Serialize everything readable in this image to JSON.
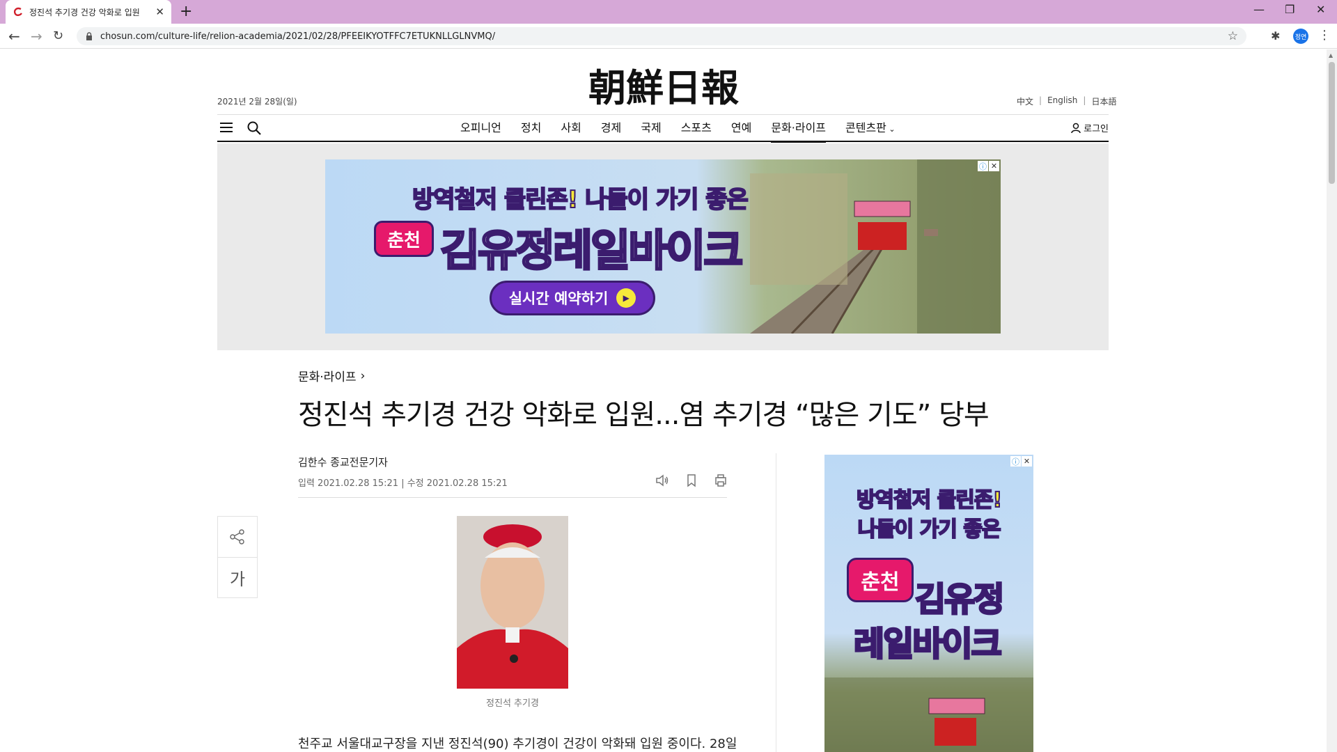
{
  "browser": {
    "tab_title": "정진석 추기경 건강 악화로 입원",
    "url": "chosun.com/culture-life/relion-academia/2021/02/28/PFEEIKYOTFFC7ETUKNLLGLNVMQ/",
    "profile_label": "정연",
    "tabbar_color": "#d6a8d7"
  },
  "header": {
    "masthead": "朝鮮日報",
    "date": "2021년 2월 28일(일)",
    "languages": [
      "中文",
      "English",
      "日本語"
    ],
    "nav": [
      "오피니언",
      "정치",
      "사회",
      "경제",
      "국제",
      "스포츠",
      "연예",
      "문화·라이프",
      "콘텐츠판"
    ],
    "active_nav": "문화·라이프",
    "login": "로그인"
  },
  "top_ad": {
    "line1_a": "방역철저 ",
    "line1_b": "클린존!",
    "line1_c": " 나들이 가기 ",
    "line1_d": "좋은",
    "city": "춘천",
    "brand": "김유정레일바이크",
    "cta": "실시간 예약하기"
  },
  "article": {
    "section": "문화·라이프",
    "headline": "정진석 추기경 건강 악화로 입원...염 추기경 “많은 기도” 당부",
    "byline": "김한수 종교전문기자",
    "dates": "입력 2021.02.28 15:21 | 수정 2021.02.28 15:21",
    "font_button": "가",
    "photo_caption": "정진석 추기경",
    "body_first_line": "천주교 서울대교구장을 지낸 정진석(90) 추기경이 건강이 악화돼 입원 중이다. 28일"
  },
  "right_ad": {
    "l1_a": "방역철저 ",
    "l1_b": "클린존!",
    "l2_a": "나들이 가기 ",
    "l2_b": "좋은",
    "city": "춘천",
    "brand_1": "김유정",
    "brand_2": "레일바이크"
  }
}
